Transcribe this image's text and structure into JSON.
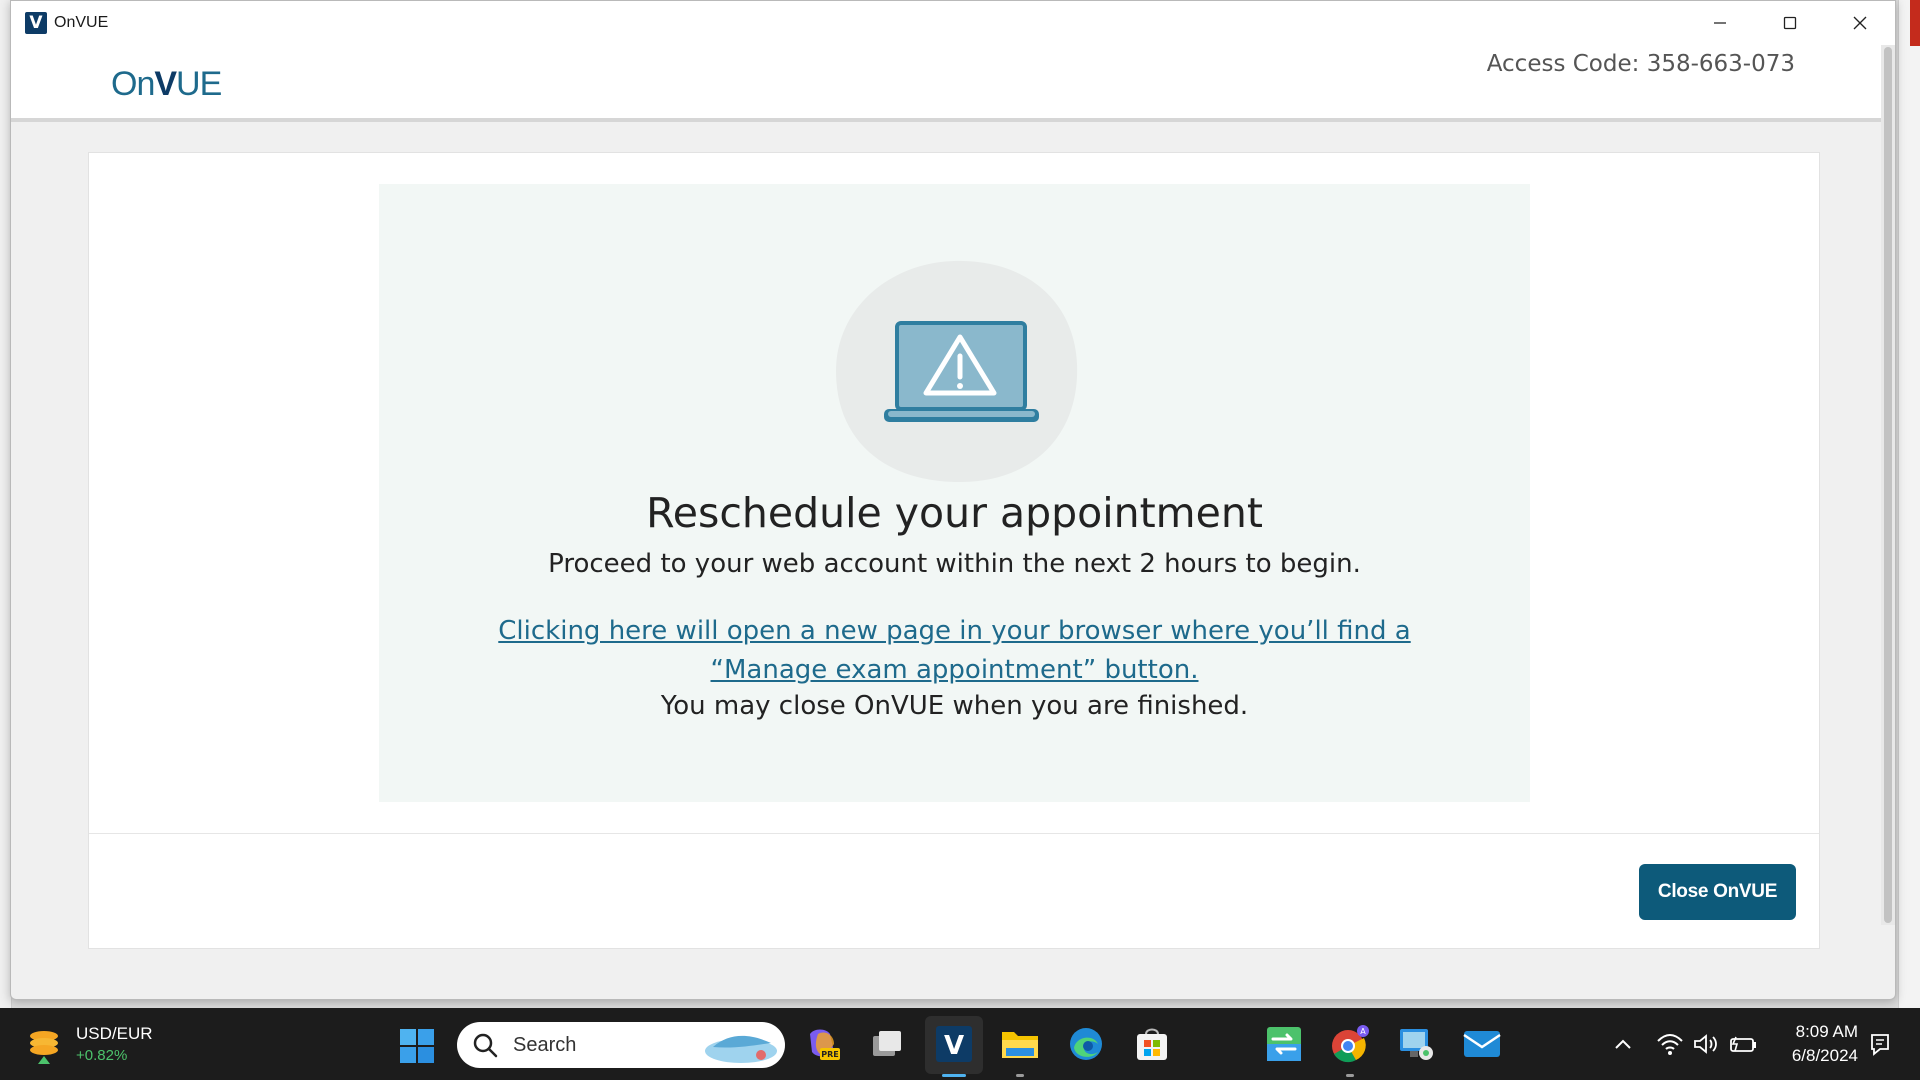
{
  "window": {
    "title": "OnVUE",
    "app_icon_letter": "V"
  },
  "header": {
    "logo_on": "On",
    "logo_v": "V",
    "logo_ue": "UE",
    "access_code": "Access Code: 358-663-073"
  },
  "content": {
    "heading": "Reschedule your appointment",
    "subtext": "Proceed to your web account within the next 2 hours to begin.",
    "link_text": "Clicking here will open a new page in your browser where you’ll find a “Manage exam appointment” button.",
    "note": "You may close OnVUE when you are finished.",
    "close_button": "Close OnVUE"
  },
  "taskbar": {
    "widget_title": "USD/EUR",
    "widget_value": "+0.82%",
    "search_placeholder": "Search",
    "time": "8:09 AM",
    "date": "6/8/2024"
  },
  "colors": {
    "brand": "#0d5a7a",
    "link": "#1e6a8c",
    "panel_bg": "#f2f7f5",
    "positive": "#4cc26b"
  }
}
